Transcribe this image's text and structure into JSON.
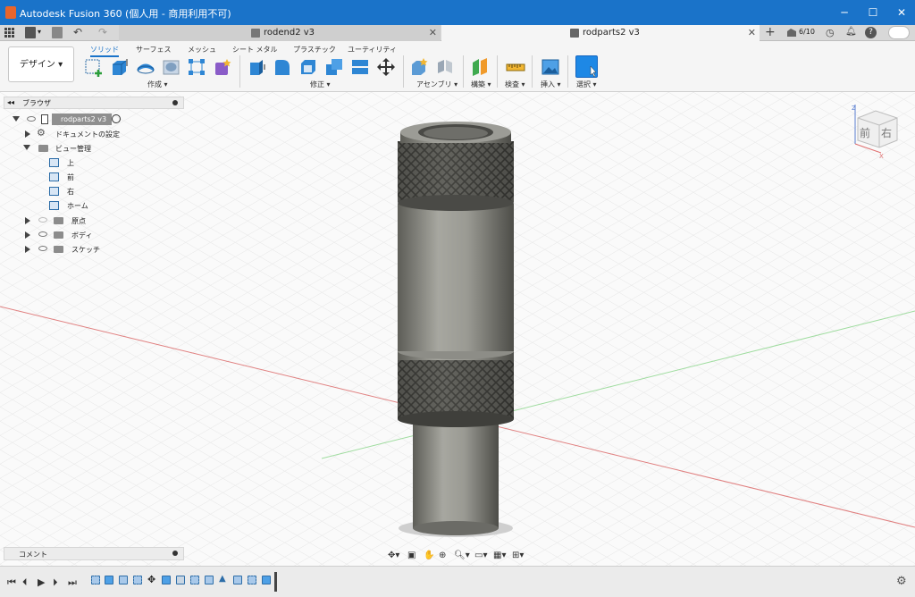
{
  "window": {
    "title": "Autodesk Fusion 360 (個人用 - 商用利用不可)",
    "minimize_icon": "minimize-icon",
    "maximize_icon": "maximize-icon",
    "close_icon": "close-icon"
  },
  "tabs": [
    {
      "label": "rodend2 v3",
      "active": false
    },
    {
      "label": "rodparts2 v3",
      "active": true
    }
  ],
  "tabbar_right": {
    "job_count": "6/10"
  },
  "ribbon": {
    "workspace": "デザイン",
    "tabs": [
      "ソリッド",
      "サーフェス",
      "メッシュ",
      "シート メタル",
      "プラスチック",
      "ユーティリティ"
    ],
    "active_tab": "ソリッド",
    "groups": [
      "作成",
      "修正",
      "アセンブリ",
      "構築",
      "検査",
      "挿入",
      "選択"
    ]
  },
  "browser": {
    "title": "ブラウザ",
    "root": "rodparts2 v3",
    "items": [
      {
        "label": "ドキュメントの設定",
        "depth": 1
      },
      {
        "label": "ビュー管理",
        "depth": 1
      },
      {
        "label": "上",
        "depth": 2
      },
      {
        "label": "前",
        "depth": 2
      },
      {
        "label": "右",
        "depth": 2
      },
      {
        "label": "ホーム",
        "depth": 2
      },
      {
        "label": "原点",
        "depth": 1
      },
      {
        "label": "ボディ",
        "depth": 1
      },
      {
        "label": "スケッチ",
        "depth": 1
      }
    ]
  },
  "viewcube": {
    "front": "前",
    "right": "右",
    "z_axis": "Z",
    "x_axis": "X"
  },
  "comments": {
    "label": "コメント"
  },
  "colors": {
    "titlebar": "#1a73c9",
    "accent": "#1a73c9",
    "part": "#8a8a82",
    "grid": "#e6e6e6",
    "x_axis": "#e07070",
    "y_axis": "#7fd07f"
  }
}
